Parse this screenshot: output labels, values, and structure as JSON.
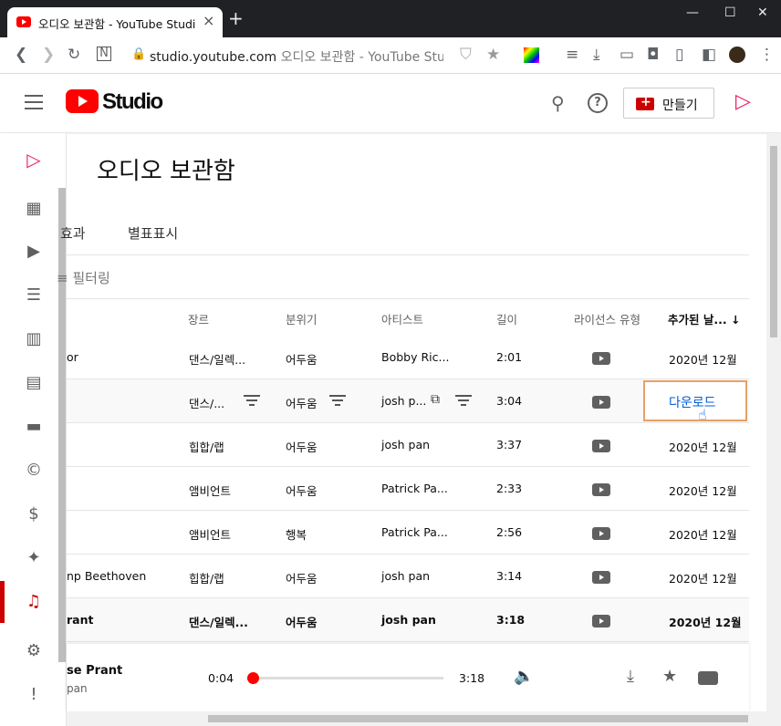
{
  "browser": {
    "tab_title": "오디오 보관함 - YouTube Studio",
    "url_host": "studio.youtube.com",
    "url_rest": "오디오 보관함 - YouTube Studio"
  },
  "header": {
    "brand": "Studio",
    "create_label": "만들기"
  },
  "page": {
    "title": "오디오 보관함",
    "tabs": [
      "효과",
      "별표표시"
    ],
    "filter_label": "필터링"
  },
  "table": {
    "headers": {
      "genre": "장르",
      "mood": "분위기",
      "artist": "아티스트",
      "length": "길이",
      "license": "라이선스 유형",
      "added": "추가된 날..."
    },
    "download_label": "다운로드",
    "rows": [
      {
        "title": "or",
        "genre": "댄스/일렉...",
        "mood": "어두움",
        "artist": "Bobby Ric...",
        "length": "2:01",
        "added": "2020년 12월"
      },
      {
        "title": "",
        "genre": "댄스/...",
        "mood": "어두움",
        "artist": "josh p...",
        "length": "3:04",
        "added": ""
      },
      {
        "title": "",
        "genre": "힙합/랩",
        "mood": "어두움",
        "artist": "josh pan",
        "length": "3:37",
        "added": "2020년 12월"
      },
      {
        "title": "",
        "genre": "앰비언트",
        "mood": "어두움",
        "artist": "Patrick Pa...",
        "length": "2:33",
        "added": "2020년 12월"
      },
      {
        "title": "",
        "genre": "앰비언트",
        "mood": "행복",
        "artist": "Patrick Pa...",
        "length": "2:56",
        "added": "2020년 12월"
      },
      {
        "title": "np Beethoven",
        "genre": "힙합/랩",
        "mood": "어두움",
        "artist": "josh pan",
        "length": "3:14",
        "added": "2020년 12월"
      },
      {
        "title": "rant",
        "genre": "댄스/일렉...",
        "mood": "어두움",
        "artist": "josh pan",
        "length": "3:18",
        "added": "2020년 12월"
      }
    ]
  },
  "player": {
    "title": "se Prant",
    "artist": "pan",
    "current": "0:04",
    "duration": "3:18",
    "progress": 0.02
  }
}
